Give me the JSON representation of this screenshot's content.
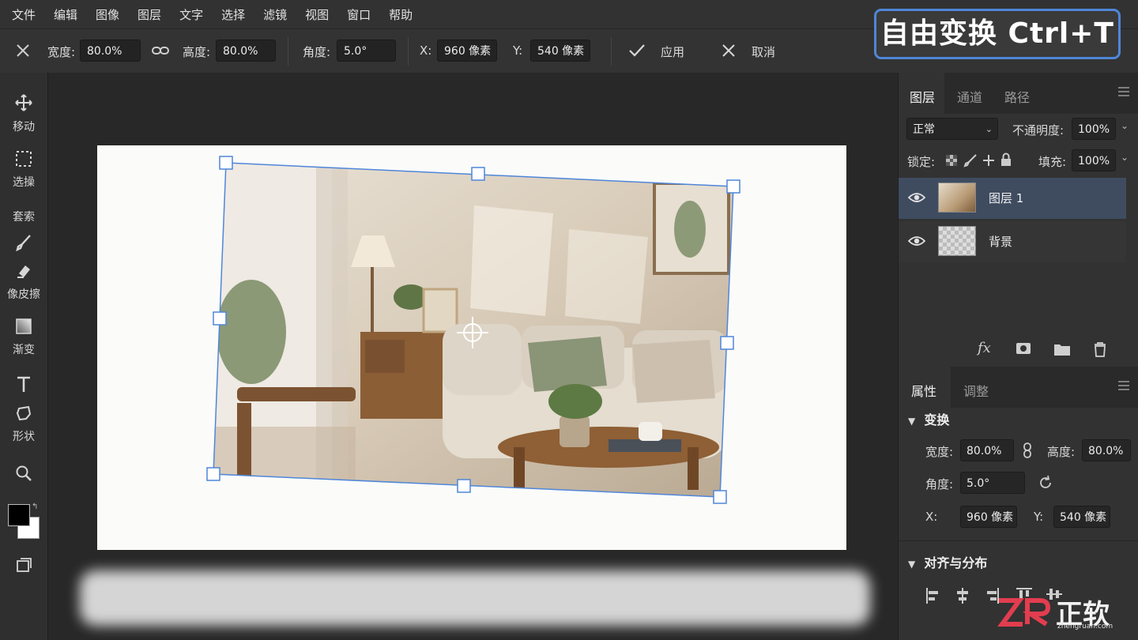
{
  "menu": [
    "文件",
    "编辑",
    "图像",
    "图层",
    "文字",
    "选择",
    "滤镜",
    "视图",
    "窗口",
    "帮助"
  ],
  "badge": "自由变换 Ctrl+T",
  "options": {
    "width_label": "宽度:",
    "width_value": "80.0%",
    "height_label": "高度:",
    "height_value": "80.0%",
    "angle_label": "角度:",
    "angle_value": "5.0°",
    "x_label": "X:",
    "x_value": "960 像素",
    "y_label": "Y:",
    "y_value": "540 像素",
    "apply_label": "应用",
    "cancel_label": "取消"
  },
  "tools": {
    "move": "移动",
    "select": "选操",
    "lasso": "套索",
    "eraser": "像皮擦",
    "gradient": "渐变",
    "shape": "形状"
  },
  "layers_panel": {
    "tabs": [
      "图层",
      "通道",
      "路径"
    ],
    "blend_mode": "正常",
    "opacity_label": "不通明度:",
    "opacity_value": "100%",
    "lock_label": "锁定:",
    "fill_label": "填充:",
    "fill_value": "100%",
    "layers": [
      {
        "name": "图层 1",
        "selected": true
      },
      {
        "name": "背景",
        "selected": false
      }
    ]
  },
  "properties_panel": {
    "tabs": [
      "属性",
      "调整"
    ],
    "transform_section": "变换",
    "width_label": "宽度:",
    "width_value": "80.0%",
    "height_label": "高度:",
    "height_value": "80.0%",
    "angle_label": "角度:",
    "angle_value": "5.0°",
    "x_label": "X:",
    "x_value": "960 像素",
    "y_label": "Y:",
    "y_value": "540 像素",
    "align_section": "对齐与分布"
  },
  "watermark": {
    "brand": "正软",
    "site": "zhengruan.com"
  },
  "colors": {
    "accent": "#4f86d8",
    "selected_layer": "#3f4c60",
    "bg": "#2b2b2b"
  }
}
